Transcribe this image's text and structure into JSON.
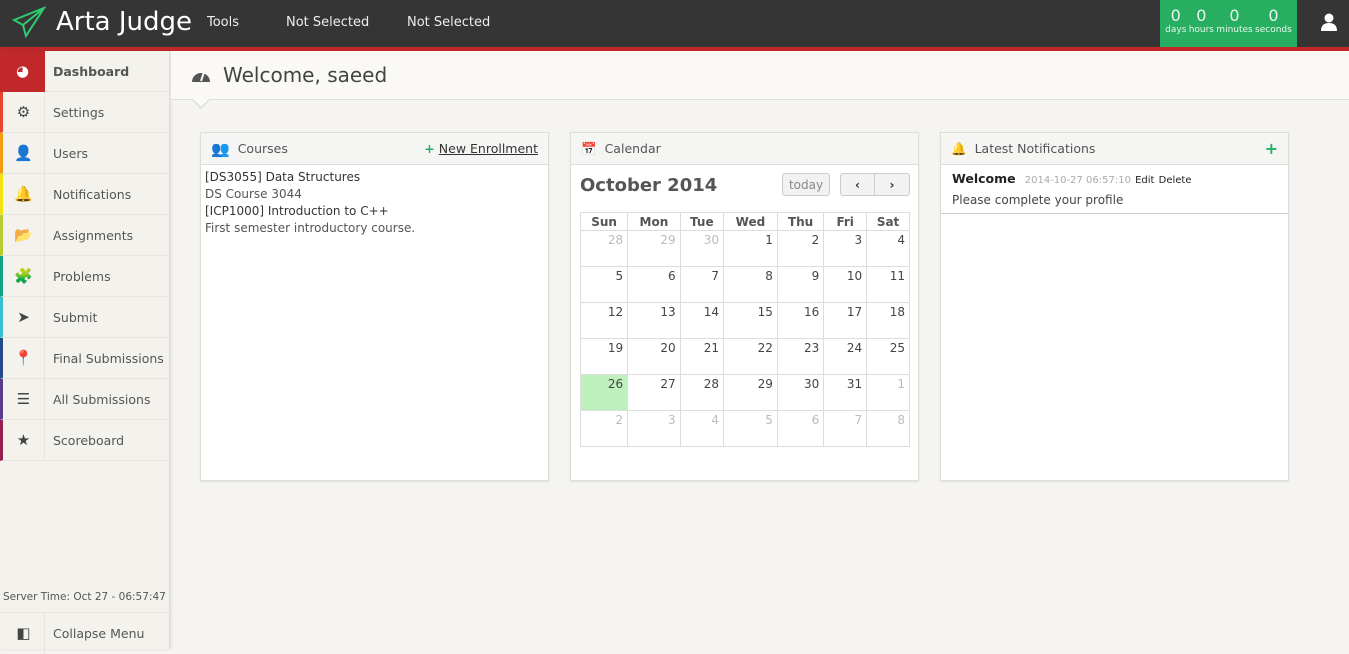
{
  "app": {
    "title": "Arta Judge"
  },
  "topnav": [
    "Tools",
    "Not Selected",
    "Not Selected"
  ],
  "timer": [
    {
      "value": "0",
      "label": "days"
    },
    {
      "value": "0",
      "label": "hours"
    },
    {
      "value": "0",
      "label": "minutes"
    },
    {
      "value": "0",
      "label": "seconds"
    }
  ],
  "colors": {
    "accent": "#c0282a",
    "timer": "#27ae60",
    "today": "#bdf0bd"
  },
  "sidebar": {
    "items": [
      {
        "label": "Dashboard",
        "icon": "dashboard-icon",
        "color": "#c0282a"
      },
      {
        "label": "Settings",
        "icon": "gear-icon",
        "color": "#e8452c"
      },
      {
        "label": "Users",
        "icon": "user-icon",
        "color": "#f39c12"
      },
      {
        "label": "Notifications",
        "icon": "bell-icon",
        "color": "#f1e10f"
      },
      {
        "label": "Assignments",
        "icon": "folder-open-icon",
        "color": "#b5cc2c"
      },
      {
        "label": "Problems",
        "icon": "puzzle-icon",
        "color": "#16a085"
      },
      {
        "label": "Submit",
        "icon": "location-arrow-icon",
        "color": "#3bbfce"
      },
      {
        "label": "Final Submissions",
        "icon": "map-marker-icon",
        "color": "#234b8c"
      },
      {
        "label": "All Submissions",
        "icon": "list-icon",
        "color": "#5b3b8c"
      },
      {
        "label": "Scoreboard",
        "icon": "star-icon",
        "color": "#962051"
      }
    ],
    "server_time": "Server Time: Oct 27 - 06:57:47",
    "collapse": "Collapse Menu"
  },
  "header": {
    "title": "Welcome, saeed"
  },
  "courses": {
    "title": "Courses",
    "action": "New Enrollment",
    "lines": [
      "[DS3055] Data Structures",
      "DS Course 3044",
      "[ICP1000] Introduction to C++",
      "First semester introductory course."
    ]
  },
  "calendar": {
    "title": "Calendar",
    "month": "October 2014",
    "today": "today",
    "days": [
      "Sun",
      "Mon",
      "Tue",
      "Wed",
      "Thu",
      "Fri",
      "Sat"
    ],
    "weeks": [
      [
        "28",
        "29",
        "30",
        "1",
        "2",
        "3",
        "4"
      ],
      [
        "5",
        "6",
        "7",
        "8",
        "9",
        "10",
        "11"
      ],
      [
        "12",
        "13",
        "14",
        "15",
        "16",
        "17",
        "18"
      ],
      [
        "19",
        "20",
        "21",
        "22",
        "23",
        "24",
        "25"
      ],
      [
        "26",
        "27",
        "28",
        "29",
        "30",
        "31",
        "1"
      ],
      [
        "2",
        "3",
        "4",
        "5",
        "6",
        "7",
        "8"
      ]
    ],
    "selected": "26"
  },
  "notifications": {
    "title": "Latest Notifications",
    "items": [
      {
        "title": "Welcome",
        "time": "2014-10-27 06:57:10",
        "edit": "Edit",
        "delete": "Delete",
        "text": "Please complete your profile"
      }
    ]
  }
}
